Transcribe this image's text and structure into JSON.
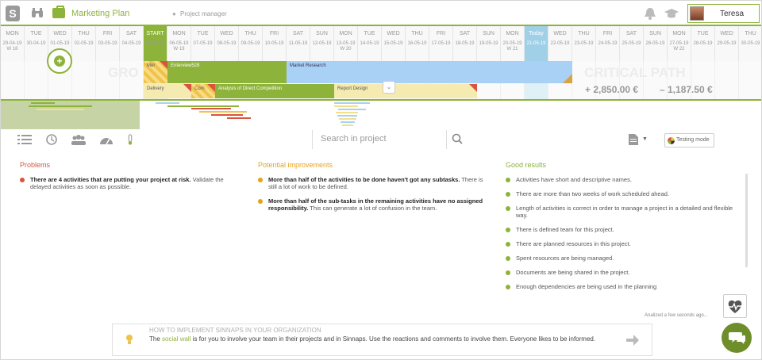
{
  "topbar": {
    "project_title": "Marketing Plan",
    "role": "Project manager",
    "user_name": "Teresa"
  },
  "calendar": {
    "days": [
      {
        "name": "MON",
        "date": "29-04-19",
        "week": "W 18"
      },
      {
        "name": "TUE",
        "date": "30-04-19",
        "week": ""
      },
      {
        "name": "WED",
        "date": "01-05-19",
        "week": ""
      },
      {
        "name": "THU",
        "date": "02-05-19",
        "week": ""
      },
      {
        "name": "FRI",
        "date": "03-05-19",
        "week": ""
      },
      {
        "name": "SAT",
        "date": "04-05-19",
        "week": ""
      },
      {
        "name": "START",
        "date": "05-05-19",
        "week": ""
      },
      {
        "name": "MON",
        "date": "06-05-19",
        "week": "W 19"
      },
      {
        "name": "TUE",
        "date": "07-05-19",
        "week": ""
      },
      {
        "name": "WED",
        "date": "08-05-19",
        "week": ""
      },
      {
        "name": "THU",
        "date": "09-05-19",
        "week": ""
      },
      {
        "name": "FRI",
        "date": "10-05-19",
        "week": ""
      },
      {
        "name": "SAT",
        "date": "11-05-19",
        "week": ""
      },
      {
        "name": "SUN",
        "date": "12-05-19",
        "week": ""
      },
      {
        "name": "MON",
        "date": "13-05-19",
        "week": "W 20"
      },
      {
        "name": "TUE",
        "date": "14-05-19",
        "week": ""
      },
      {
        "name": "WED",
        "date": "15-05-19",
        "week": ""
      },
      {
        "name": "THU",
        "date": "16-05-19",
        "week": ""
      },
      {
        "name": "FRI",
        "date": "17-05-19",
        "week": ""
      },
      {
        "name": "SAT",
        "date": "18-05-19",
        "week": ""
      },
      {
        "name": "SUN",
        "date": "19-05-19",
        "week": ""
      },
      {
        "name": "MON",
        "date": "20-05-19",
        "week": "W 21"
      },
      {
        "name": "Today",
        "date": "21-05-19",
        "week": ""
      },
      {
        "name": "WED",
        "date": "22-05-19",
        "week": ""
      },
      {
        "name": "THU",
        "date": "23-05-19",
        "week": ""
      },
      {
        "name": "FRI",
        "date": "24-05-19",
        "week": ""
      },
      {
        "name": "SAT",
        "date": "25-05-19",
        "week": ""
      },
      {
        "name": "SUN",
        "date": "26-05-19",
        "week": ""
      },
      {
        "name": "MON",
        "date": "27-05-19",
        "week": "W 22"
      },
      {
        "name": "TUE",
        "date": "28-05-19",
        "week": ""
      },
      {
        "name": "WED",
        "date": "29-05-19",
        "week": ""
      },
      {
        "name": "THU",
        "date": "30-05-19",
        "week": ""
      }
    ]
  },
  "gantt": {
    "bars": {
      "mer": "Mer",
      "interview": "Enterview528",
      "market": "Market Research",
      "delivery": "Delivery",
      "com": "Com",
      "analysis": "Analysis of Direct Competition",
      "report": "Report Design"
    },
    "ghost_left": "GRO",
    "ghost_right": "CRITICAL PATH",
    "income": "+ 2,850.00 €",
    "expense": "– 1,187.50 €"
  },
  "toolbar": {
    "search_placeholder": "Search in project",
    "testing_label": "Testing mode"
  },
  "analysis": {
    "problems": {
      "title": "Problems",
      "items": [
        {
          "bold": "There are 4 activities that are putting your project at risk.",
          "text": " Validate the delayed activities as soon as possible."
        }
      ]
    },
    "improvements": {
      "title": "Potential improvements",
      "items": [
        {
          "bold": "More than half of the activities to be done haven't got any subtasks.",
          "text": " There is still a lot of work to be defined."
        },
        {
          "bold": "More than half of the sub-tasks in the remaining activities have no assigned responsibility.",
          "text": " This can generate a lot of confusion in the team."
        }
      ]
    },
    "good": {
      "title": "Good results",
      "items": [
        "Activities have short and descriptive names.",
        "There are more than two weeks of work scheduled ahead.",
        "Length of activities is correct in order to manage a project in a detailed and flexible way.",
        "There is defined team for this project.",
        "There are planned resources in this project.",
        "Spent resources are being managed.",
        "Documents are being shared in the project.",
        "Enough dependencies are being used in the planning"
      ]
    },
    "analyzed": "Analized a few seconds ago..."
  },
  "tip": {
    "title": "HOW TO IMPLEMENT SINNAPS IN YOUR ORGANIZATION",
    "pre": "The ",
    "link": "social wall",
    "post": " is for you to involve your team in their projects and in Sinnaps. Use the reactions and comments to involve them. Everyone likes to be informed."
  },
  "colors": {
    "accent": "#8db33a",
    "problem": "#d9543f",
    "improvement": "#e8a21a",
    "good": "#8db33a"
  }
}
